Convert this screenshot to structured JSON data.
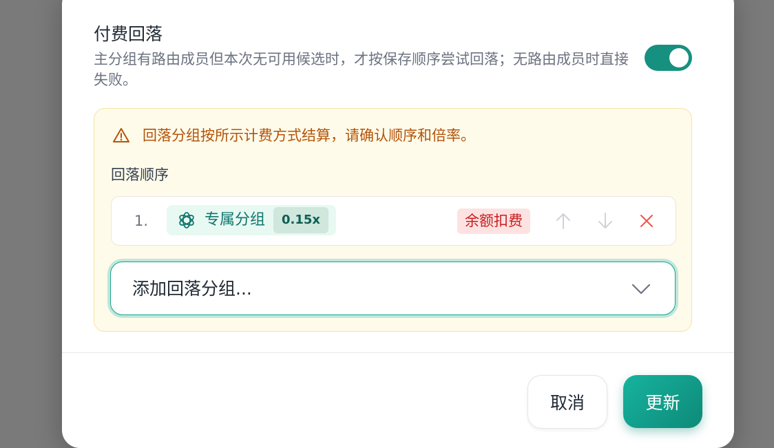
{
  "fallback": {
    "title": "付费回落",
    "description": "主分组有路由成员但本次无可用候选时，才按保存顺序尝试回落；无路由成员时直接失败。",
    "enabled": true,
    "warning": "回落分组按所示计费方式结算，请确认顺序和倍率。",
    "order_label": "回落顺序",
    "groups": [
      {
        "index": "1.",
        "name": "专属分组",
        "rate": "0.15x",
        "billing": "余额扣费"
      }
    ],
    "add_placeholder": "添加回落分组..."
  },
  "footer": {
    "cancel_label": "取消",
    "update_label": "更新"
  },
  "colors": {
    "accent": "#16907f",
    "warning_text": "#b45309",
    "warning_bg": "#fefbea",
    "billing_bg": "#fde2e2",
    "billing_text": "#c81e1e",
    "remove_icon": "#ef5350"
  },
  "icons": {
    "warning": "warning-triangle-icon",
    "group": "openai-icon",
    "move_up": "arrow-up-icon",
    "move_down": "arrow-down-icon",
    "remove": "close-icon",
    "dropdown": "chevron-down-icon"
  }
}
